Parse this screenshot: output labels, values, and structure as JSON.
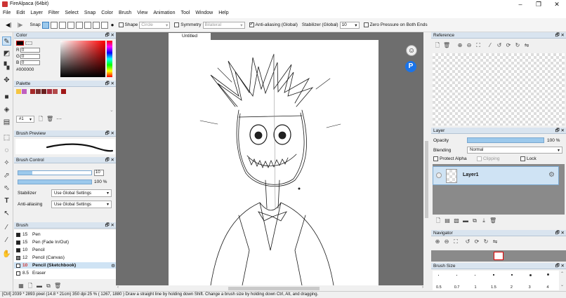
{
  "window": {
    "title": "FireAlpaca (64bit)",
    "minimize": "–",
    "maximize": "❐",
    "close": "✕"
  },
  "menu": [
    "File",
    "Edit",
    "Layer",
    "Filter",
    "Select",
    "Snap",
    "Color",
    "Brush",
    "View",
    "Animation",
    "Tool",
    "Window",
    "Help"
  ],
  "toolbar": {
    "snap_label": "Snap",
    "shape_label": "Shape",
    "shape_value": "Circle",
    "symmetry_label": "Symmetry",
    "symmetry_value": "Bilateral",
    "antialias_label": "Anti-aliasing (Global)",
    "stabilizer_label": "Stabilizer (Global)",
    "stabilizer_value": "10",
    "zero_pressure_label": "Zero Pressure on Both Ends"
  },
  "color_panel": {
    "title": "Color",
    "r_label": "R",
    "r_value": "0",
    "g_label": "G",
    "g_value": "0",
    "b_label": "B",
    "b_value": "0",
    "hex": "#000000"
  },
  "palette_panel": {
    "title": "Palette",
    "swatches": [
      "#f5c542",
      "#c060c0",
      "#a62a2a",
      "#7a3030",
      "#6a2020",
      "#a83040",
      "#b34a4a",
      "#a01818"
    ],
    "set_value": "#1"
  },
  "brush_preview": {
    "title": "Brush Preview"
  },
  "brush_control": {
    "title": "Brush Control",
    "size_value": "10",
    "opacity_value": "100 %",
    "stabilizer_label": "Stabilizer",
    "stabilizer_value": "Use Global Settings",
    "antialias_label": "Anti-aliasing",
    "antialias_value": "Use Global Settings"
  },
  "brush_panel": {
    "title": "Brush",
    "items": [
      {
        "size": "15",
        "name": "Pen"
      },
      {
        "size": "15",
        "name": "Pen (Fade In/Out)"
      },
      {
        "size": "10",
        "name": "Pencil"
      },
      {
        "size": "12",
        "name": "Pencil (Canvas)"
      },
      {
        "size": "10",
        "name": "Pencil (Sketchbook)"
      },
      {
        "size": "8.5",
        "name": "Eraser"
      }
    ]
  },
  "canvas": {
    "tab": "Untitled"
  },
  "reference_panel": {
    "title": "Reference"
  },
  "layer_panel": {
    "title": "Layer",
    "opacity_label": "Opacity",
    "opacity_value": "100 %",
    "blending_label": "Blending",
    "blending_value": "Normal",
    "protect_alpha": "Protect Alpha",
    "clipping": "Clipping",
    "lock": "Lock",
    "layer_name": "Layer1"
  },
  "navigator_panel": {
    "title": "Navigator"
  },
  "brushsize_panel": {
    "title": "Brush Size",
    "sizes": [
      "0.5",
      "0.7",
      "1",
      "1.5",
      "2",
      "3",
      "4"
    ]
  },
  "status": "[Ctrl]  2039 * 2893 pixel  (14.8 * 21cm)  350 dpi  25 %  ( 1267, 1880 )  Draw a straight line by holding down Shift. Change a brush size by holding down Ctrl, Alt, and dragging."
}
